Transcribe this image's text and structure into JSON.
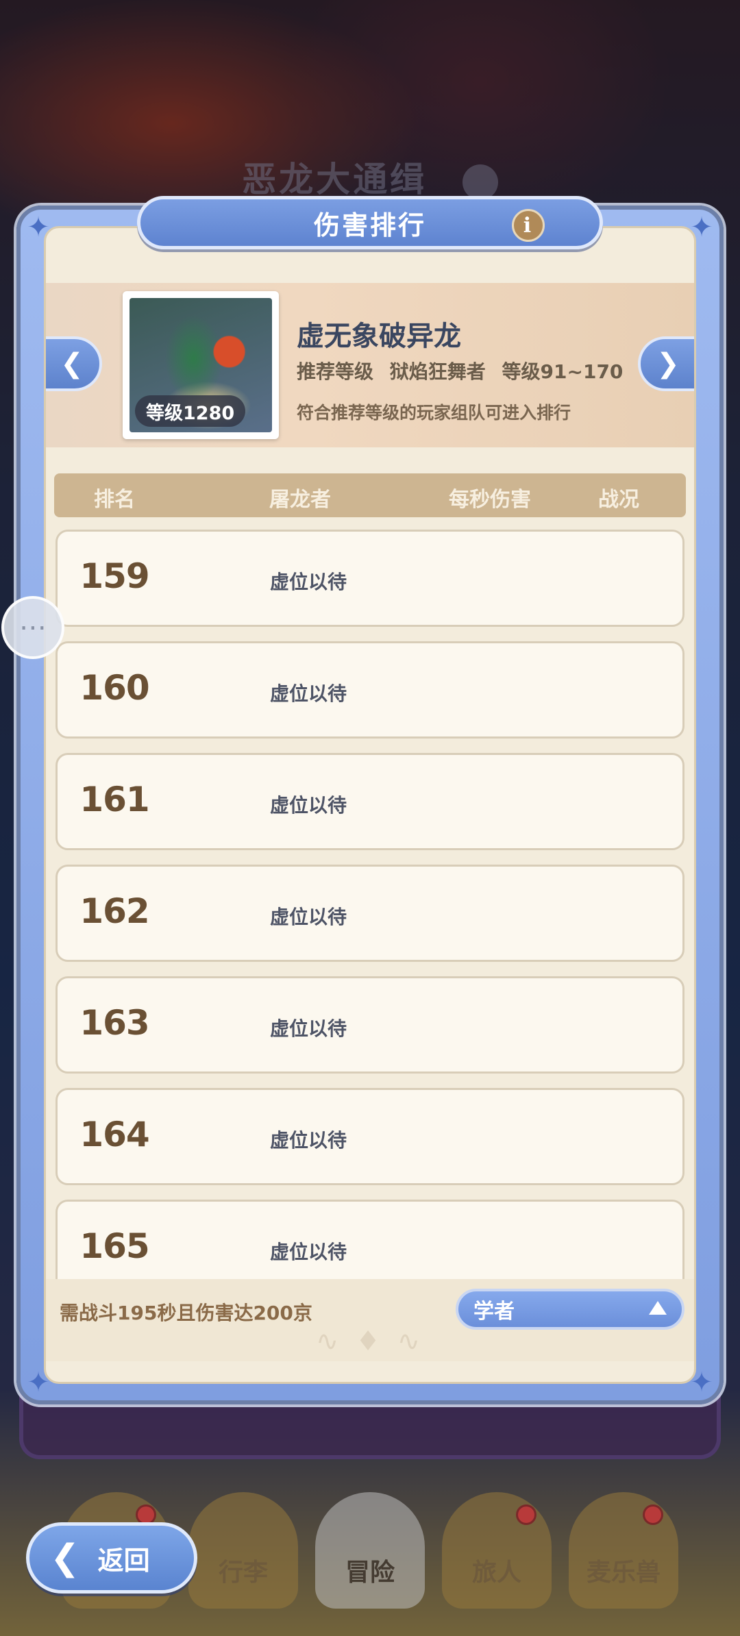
{
  "background": {
    "title": "恶龙大通缉"
  },
  "modal": {
    "title": "伤害排行",
    "info_icon": "info-icon"
  },
  "dragon": {
    "name": "虚无象破异龙",
    "level_badge": "等级1280",
    "recommend_label": "推荐等级",
    "recommend_tier": "狱焰狂舞者",
    "recommend_range": "等级91~170",
    "note": "符合推荐等级的玩家组队可进入排行",
    "prev_icon": "chevron-left-icon",
    "next_icon": "chevron-right-icon"
  },
  "table": {
    "headers": {
      "rank": "排名",
      "player": "屠龙者",
      "dps": "每秒伤害",
      "status": "战况"
    },
    "rows": [
      {
        "rank": "159",
        "player": "虚位以待"
      },
      {
        "rank": "160",
        "player": "虚位以待"
      },
      {
        "rank": "161",
        "player": "虚位以待"
      },
      {
        "rank": "162",
        "player": "虚位以待"
      },
      {
        "rank": "163",
        "player": "虚位以待"
      },
      {
        "rank": "164",
        "player": "虚位以待"
      },
      {
        "rank": "165",
        "player": "虚位以待"
      }
    ]
  },
  "footer": {
    "requirement": "需战斗195秒且伤害达200京",
    "class_select": "学者"
  },
  "back_button": {
    "label": "返回"
  },
  "bottom_nav": {
    "tabs": [
      {
        "label": "",
        "badge": true
      },
      {
        "label": "行李",
        "badge": false
      },
      {
        "label": "冒险",
        "badge": false,
        "active": true
      },
      {
        "label": "旅人",
        "badge": true
      },
      {
        "label": "麦乐兽",
        "badge": true
      }
    ]
  },
  "colors": {
    "accent_blue": "#5e83d0",
    "panel_beige": "#f3ecdc",
    "rank_text": "#6a5034"
  }
}
